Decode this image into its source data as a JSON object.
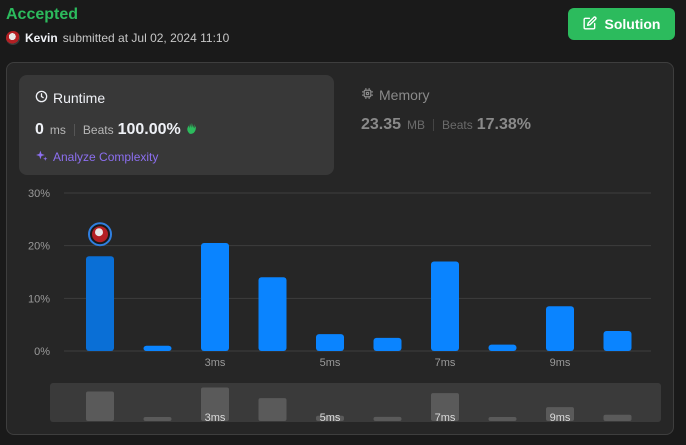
{
  "header": {
    "status": "Accepted",
    "submitter": "Kevin",
    "submitted_text": "submitted at Jul 02, 2024 11:10",
    "solution_label": "Solution"
  },
  "runtime": {
    "title": "Runtime",
    "value": "0",
    "unit": "ms",
    "beats_label": "Beats",
    "beats_value": "100.00%",
    "analyze_label": "Analyze Complexity"
  },
  "memory": {
    "title": "Memory",
    "value": "23.35",
    "unit": "MB",
    "beats_label": "Beats",
    "beats_value": "17.38%"
  },
  "colors": {
    "accepted": "#2cbb5d",
    "bar": "#0a84ff",
    "bar_selected": "#0a6fd6",
    "analyze": "#8c6ff0"
  },
  "chart_data": {
    "type": "bar",
    "categories": [
      "",
      "",
      "3ms",
      "",
      "5ms",
      "",
      "7ms",
      "",
      "9ms",
      ""
    ],
    "values": [
      18,
      1,
      20.5,
      14,
      3.2,
      2.5,
      17,
      1.2,
      8.5,
      3.8
    ],
    "selected_index": 0,
    "ylim": [
      0,
      30
    ],
    "yticks": [
      "0%",
      "10%",
      "20%",
      "30%"
    ],
    "grid": true,
    "minimap_values": [
      18,
      1,
      20.5,
      14,
      3.2,
      2.5,
      17,
      1.2,
      8.5,
      3.8
    ],
    "minimap_labels": [
      "",
      "",
      "3ms",
      "",
      "5ms",
      "",
      "7ms",
      "",
      "9ms",
      ""
    ]
  }
}
